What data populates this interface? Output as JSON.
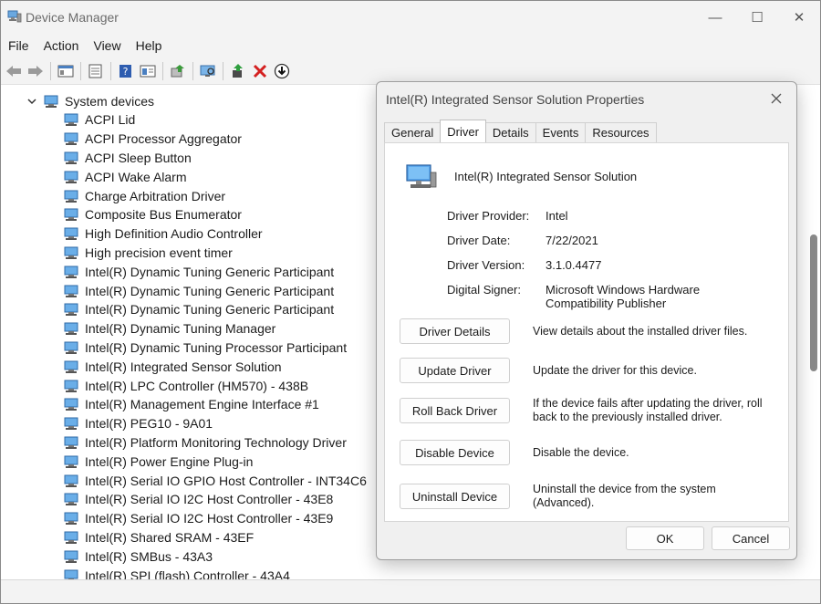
{
  "window": {
    "title": "Device Manager",
    "controls": {
      "minimize": "—",
      "maximize": "☐",
      "close": "✕"
    }
  },
  "menu": [
    "File",
    "Action",
    "View",
    "Help"
  ],
  "toolbar": [
    "back-icon",
    "forward-icon",
    "show-hide-tree-icon",
    "properties-icon",
    "help-icon",
    "view-icon",
    "update-driver-icon",
    "scan-hardware-icon",
    "enable-device-icon",
    "uninstall-device-icon",
    "download-icon"
  ],
  "tree": {
    "category": "System devices",
    "items": [
      "ACPI Lid",
      "ACPI Processor Aggregator",
      "ACPI Sleep Button",
      "ACPI Wake Alarm",
      "Charge Arbitration Driver",
      "Composite Bus Enumerator",
      "High Definition Audio Controller",
      "High precision event timer",
      "Intel(R) Dynamic Tuning Generic Participant",
      "Intel(R) Dynamic Tuning Generic Participant",
      "Intel(R) Dynamic Tuning Generic Participant",
      "Intel(R) Dynamic Tuning Manager",
      "Intel(R) Dynamic Tuning Processor Participant",
      "Intel(R) Integrated Sensor Solution",
      "Intel(R) LPC Controller (HM570) - 438B",
      "Intel(R) Management Engine Interface #1",
      "Intel(R) PEG10 - 9A01",
      "Intel(R) Platform Monitoring Technology Driver",
      "Intel(R) Power Engine Plug-in",
      "Intel(R) Serial IO GPIO Host Controller - INT34C6",
      "Intel(R) Serial IO I2C Host Controller - 43E8",
      "Intel(R) Serial IO I2C Host Controller - 43E9",
      "Intel(R) Shared SRAM - 43EF",
      "Intel(R) SMBus - 43A3",
      "Intel(R) SPI (flash) Controller - 43A4"
    ]
  },
  "dialog": {
    "title": "Intel(R) Integrated Sensor Solution Properties",
    "tabs": [
      "General",
      "Driver",
      "Details",
      "Events",
      "Resources"
    ],
    "active_tab": "Driver",
    "device_name": "Intel(R) Integrated Sensor Solution",
    "properties": [
      {
        "key": "Driver Provider:",
        "value": "Intel"
      },
      {
        "key": "Driver Date:",
        "value": "7/22/2021"
      },
      {
        "key": "Driver Version:",
        "value": "3.1.0.4477"
      },
      {
        "key": "Digital Signer:",
        "value": "Microsoft Windows Hardware Compatibility Publisher"
      }
    ],
    "actions": [
      {
        "label": "Driver Details",
        "description": "View details about the installed driver files."
      },
      {
        "label": "Update Driver",
        "description": "Update the driver for this device."
      },
      {
        "label": "Roll Back Driver",
        "description": "If the device fails after updating the driver, roll back to the previously installed driver."
      },
      {
        "label": "Disable Device",
        "description": "Disable the device."
      },
      {
        "label": "Uninstall Device",
        "description": "Uninstall the device from the system (Advanced)."
      }
    ],
    "ok_label": "OK",
    "cancel_label": "Cancel"
  }
}
